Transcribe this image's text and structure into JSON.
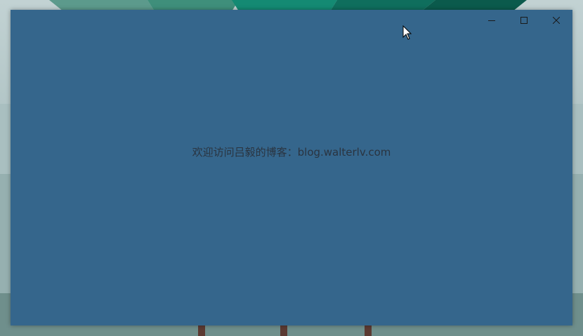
{
  "window": {
    "background_color": "#35668c",
    "caption_buttons": [
      {
        "name": "minimize",
        "icon": "minimize-icon"
      },
      {
        "name": "maximize",
        "icon": "maximize-icon"
      },
      {
        "name": "close",
        "icon": "close-icon"
      }
    ],
    "welcome_text": "欢迎访问吕毅的博客：blog.walterlv.com"
  },
  "desktop": {
    "wallpaper_colors": {
      "sky": "#b4c7c8",
      "tree_teal": "#14806d",
      "ground": "#6f8f8c",
      "trunk": "#5b3a32"
    }
  }
}
